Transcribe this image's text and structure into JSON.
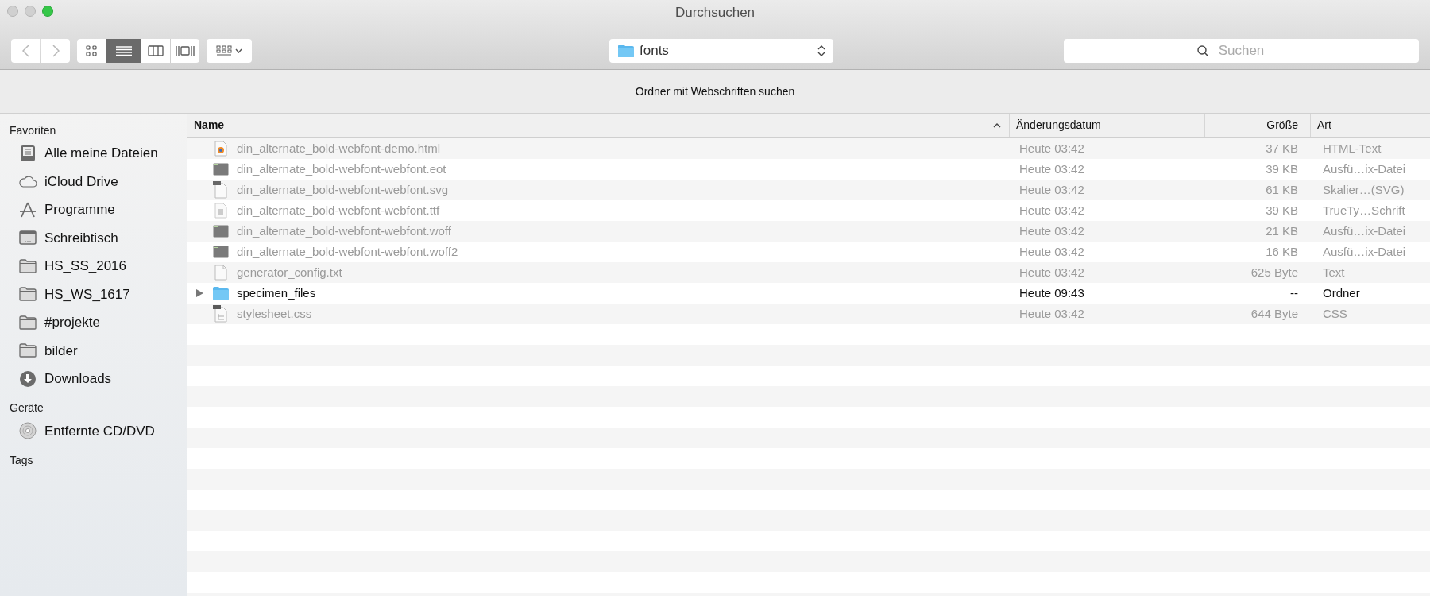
{
  "window": {
    "title": "Durchsuchen"
  },
  "toolbar": {
    "view_modes": [
      {
        "kind": "icons",
        "selected": false
      },
      {
        "kind": "list",
        "selected": true
      },
      {
        "kind": "columns",
        "selected": false
      },
      {
        "kind": "coverflow",
        "selected": false
      }
    ],
    "path": "fonts",
    "search": {
      "placeholder": "Suchen"
    }
  },
  "message": "Ordner mit Webschriften suchen",
  "sidebar": {
    "sections": [
      {
        "title": "Favoriten",
        "items": [
          {
            "label": "Alle meine Dateien",
            "kind": "files"
          },
          {
            "label": "iCloud Drive",
            "kind": "cloud"
          },
          {
            "label": "Programme",
            "kind": "apps"
          },
          {
            "label": "Schreibtisch",
            "kind": "desktop"
          },
          {
            "label": "HS_SS_2016",
            "kind": "folder"
          },
          {
            "label": "HS_WS_1617",
            "kind": "folder"
          },
          {
            "label": "#projekte",
            "kind": "folder"
          },
          {
            "label": "bilder",
            "kind": "folder"
          },
          {
            "label": "Downloads",
            "kind": "downloads"
          }
        ]
      },
      {
        "title": "Geräte",
        "items": [
          {
            "label": "Entfernte CD/DVD",
            "kind": "disc"
          }
        ]
      },
      {
        "title": "Tags"
      }
    ]
  },
  "table": {
    "columns": [
      {
        "label": "Name",
        "sorted": true
      },
      {
        "label": "Änderungsdatum",
        "sorted": false
      },
      {
        "label": "Größe",
        "sorted": false
      },
      {
        "label": "Art",
        "sorted": false
      }
    ],
    "rows": [
      {
        "name": "din_alternate_bold-webfont-demo.html",
        "kind": "html",
        "disabled": true,
        "date": "Heute 03:42",
        "size": "37 KB",
        "type": "HTML-Text"
      },
      {
        "name": "din_alternate_bold-webfont-webfont.eot",
        "kind": "binary",
        "disabled": true,
        "date": "Heute 03:42",
        "size": "39 KB",
        "type": "Ausfü…ix-Datei"
      },
      {
        "name": "din_alternate_bold-webfont-webfont.svg",
        "kind": "svg",
        "disabled": true,
        "date": "Heute 03:42",
        "size": "61 KB",
        "type": "Skalier…(SVG)"
      },
      {
        "name": "din_alternate_bold-webfont-webfont.ttf",
        "kind": "font",
        "disabled": true,
        "date": "Heute 03:42",
        "size": "39 KB",
        "type": "TrueTy…Schrift"
      },
      {
        "name": "din_alternate_bold-webfont-webfont.woff",
        "kind": "binary",
        "disabled": true,
        "date": "Heute 03:42",
        "size": "21 KB",
        "type": "Ausfü…ix-Datei"
      },
      {
        "name": "din_alternate_bold-webfont-webfont.woff2",
        "kind": "binary",
        "disabled": true,
        "date": "Heute 03:42",
        "size": "16 KB",
        "type": "Ausfü…ix-Datei"
      },
      {
        "name": "generator_config.txt",
        "kind": "text",
        "disabled": true,
        "date": "Heute 03:42",
        "size": "625 Byte",
        "type": "Text"
      },
      {
        "name": "specimen_files",
        "kind": "folder",
        "disabled": false,
        "date": "Heute 09:43",
        "size": "--",
        "type": "Ordner"
      },
      {
        "name": "stylesheet.css",
        "kind": "css",
        "disabled": true,
        "date": "Heute 03:42",
        "size": "644 Byte",
        "type": "CSS"
      }
    ]
  }
}
